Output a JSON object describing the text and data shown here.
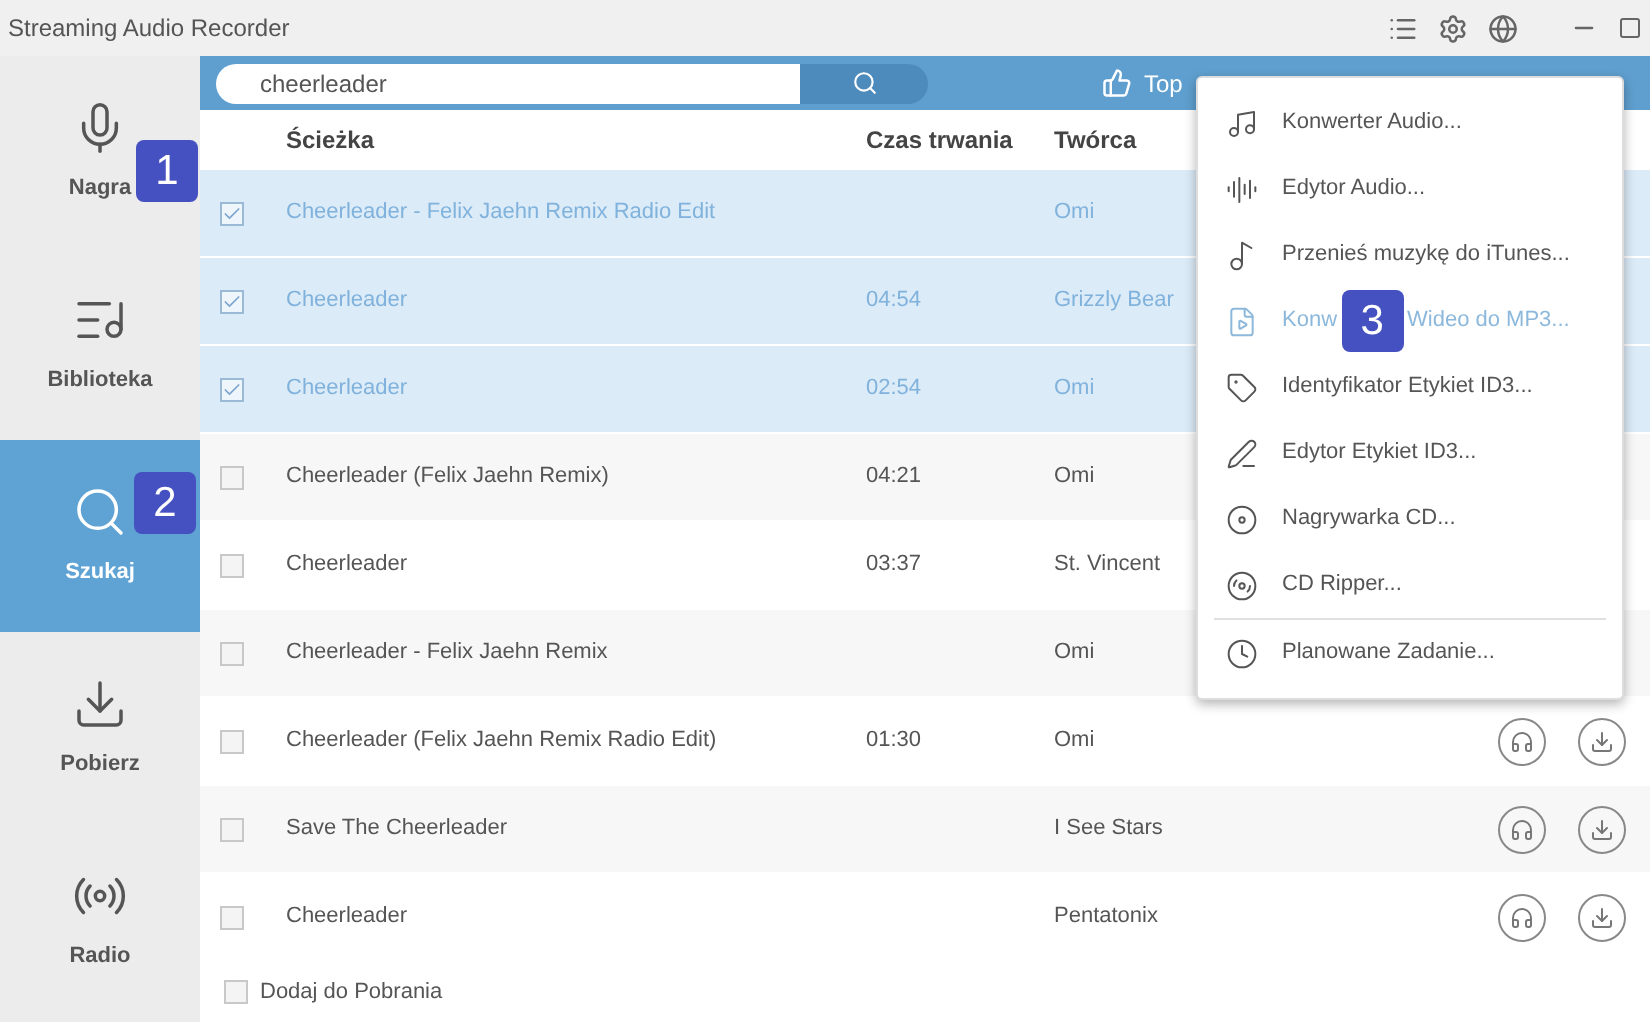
{
  "window": {
    "title": "Streaming Audio Recorder"
  },
  "sidebar": {
    "items": [
      {
        "label": "Nagra",
        "selected": false,
        "annotation": "1"
      },
      {
        "label": "Biblioteka",
        "selected": false
      },
      {
        "label": "Szukaj",
        "selected": true,
        "annotation": "2"
      },
      {
        "label": "Pobierz",
        "selected": false
      },
      {
        "label": "Radio",
        "selected": false
      }
    ]
  },
  "search": {
    "value": "cheerleader"
  },
  "top_link": "Top",
  "table": {
    "columns": [
      "Ścieżka",
      "Czas trwania",
      "Twórca"
    ],
    "rows": [
      {
        "title": "Cheerleader - Felix Jaehn Remix Radio Edit",
        "artist": "Omi",
        "checked": true,
        "actions_visible": false
      },
      {
        "title": "Cheerleader",
        "duration": "04:54",
        "artist": "Grizzly Bear",
        "checked": true,
        "actions_visible": false
      },
      {
        "title": "Cheerleader",
        "duration": "02:54",
        "artist": "Omi",
        "checked": true,
        "actions_visible": false
      },
      {
        "title": "Cheerleader (Felix Jaehn Remix)",
        "duration": "04:21",
        "artist": "Omi",
        "checked": false,
        "actions_visible": false
      },
      {
        "title": "Cheerleader",
        "duration": "03:37",
        "artist": "St. Vincent",
        "checked": false,
        "actions_visible": false
      },
      {
        "title": "Cheerleader - Felix Jaehn Remix",
        "artist": "Omi",
        "checked": false,
        "actions_visible": false
      },
      {
        "title": "Cheerleader (Felix Jaehn Remix Radio Edit)",
        "duration": "01:30",
        "artist": "Omi",
        "checked": false,
        "actions_visible": true
      },
      {
        "title": "Save The Cheerleader",
        "artist": "I See Stars",
        "checked": false,
        "actions_visible": true
      },
      {
        "title": "Cheerleader",
        "artist": "Pentatonix",
        "checked": false,
        "actions_visible": true
      }
    ]
  },
  "footer": {
    "label": "Dodaj do Pobrania",
    "checked": false
  },
  "menu": {
    "items": [
      {
        "label": "Konwerter Audio...",
        "selected": false
      },
      {
        "label": "Edytor Audio...",
        "selected": false
      },
      {
        "label": "Przenieś muzykę do iTunes...",
        "selected": false
      },
      {
        "label": "Konw",
        "label_rest": "Wideo do MP3...",
        "selected": true,
        "annotation": "3"
      },
      {
        "label": "Identyfikator Etykiet ID3...",
        "selected": false
      },
      {
        "label": "Edytor Etykiet ID3...",
        "selected": false
      },
      {
        "label": "Nagrywarka CD...",
        "selected": false
      },
      {
        "label": "CD Ripper...",
        "selected": false
      },
      {
        "label": "Planowane Zadanie...",
        "selected": false,
        "divider_before": true
      }
    ]
  }
}
